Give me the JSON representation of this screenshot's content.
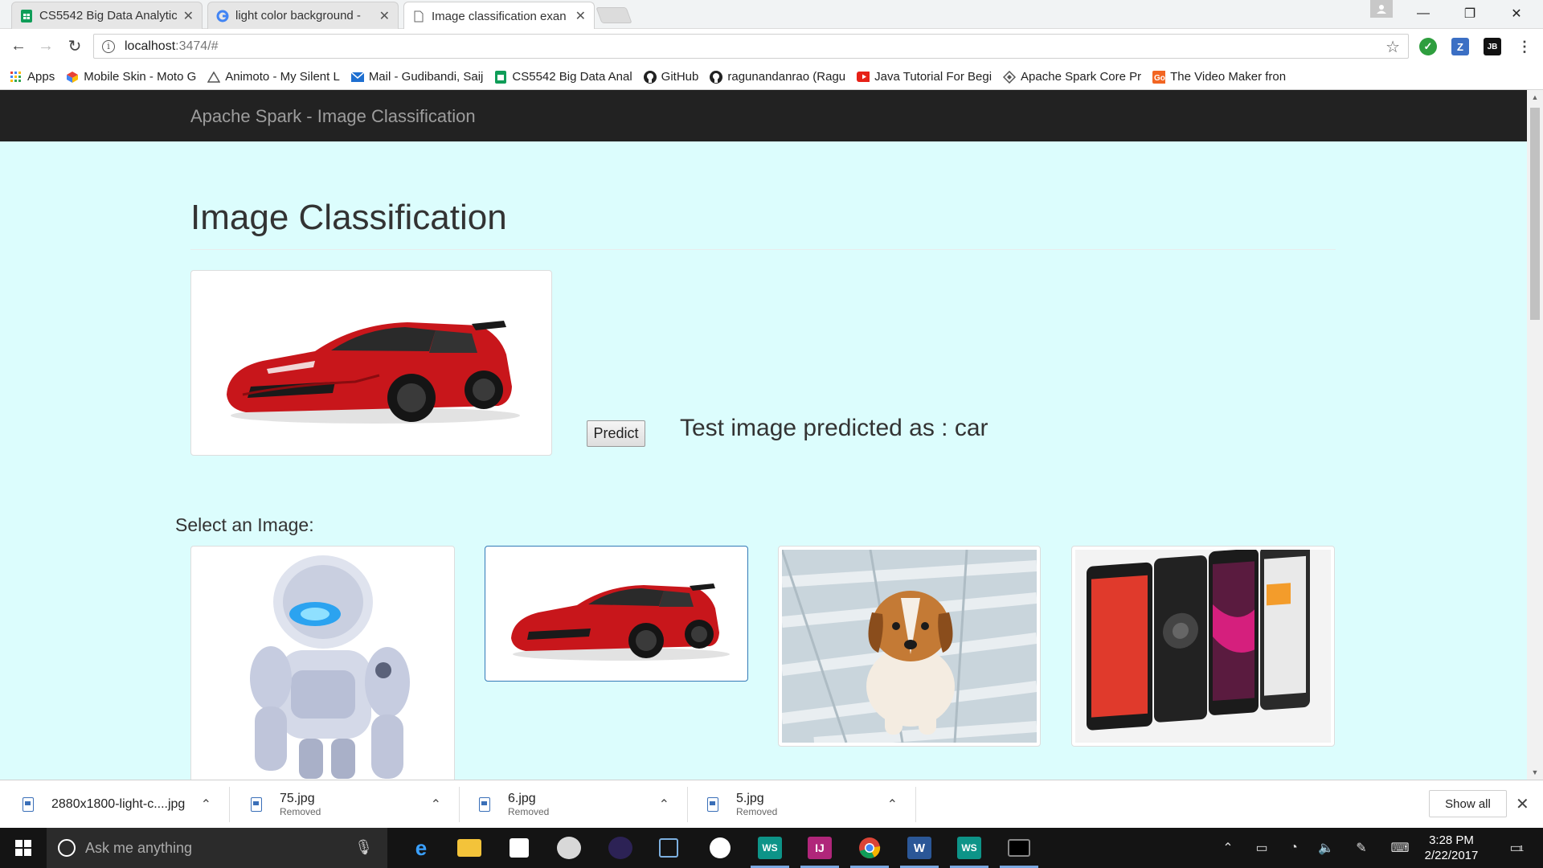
{
  "tabs": [
    {
      "title": "CS5542 Big Data Analytic",
      "icon": "sheets-icon",
      "color": "#0f9d58"
    },
    {
      "title": "light color background -",
      "icon": "google-icon",
      "color": "#4285f4"
    },
    {
      "title": "Image classification exan",
      "icon": "page-icon",
      "color": "#666666"
    }
  ],
  "toolbar": {
    "url_host": "localhost",
    "url_path": ":3474/#"
  },
  "bookmarks": [
    {
      "label": "Apps",
      "icon": "apps-grid-icon"
    },
    {
      "label": "Mobile Skin - Moto G",
      "icon": "cube-icon"
    },
    {
      "label": "Animoto - My Silent L",
      "icon": "animoto-icon"
    },
    {
      "label": "Mail - Gudibandi, Saij",
      "icon": "mail-icon"
    },
    {
      "label": "CS5542 Big Data Anal",
      "icon": "sheets-icon"
    },
    {
      "label": "GitHub",
      "icon": "github-icon"
    },
    {
      "label": "ragunandanrao (Ragu",
      "icon": "github-icon"
    },
    {
      "label": "Java Tutorial For Begi",
      "icon": "youtube-icon"
    },
    {
      "label": "Apache Spark Core Pr",
      "icon": "diamond-icon"
    },
    {
      "label": "The Video Maker fron",
      "icon": "goanimate-icon"
    }
  ],
  "page": {
    "brand": "Apache Spark - Image Classification",
    "title": "Image Classification",
    "predict_label": "Predict",
    "result_text": "Test image predicted as : car",
    "select_label": "Select an Image:",
    "gallery": [
      {
        "subject": "robot",
        "selected": false
      },
      {
        "subject": "red sports car",
        "selected": true
      },
      {
        "subject": "puppy",
        "selected": false
      },
      {
        "subject": "smartphones",
        "selected": false
      }
    ]
  },
  "downloads": [
    {
      "name": "2880x1800-light-c....jpg",
      "status": ""
    },
    {
      "name": "75.jpg",
      "status": "Removed"
    },
    {
      "name": "6.jpg",
      "status": "Removed"
    },
    {
      "name": "5.jpg",
      "status": "Removed"
    }
  ],
  "downloads_show_all": "Show all",
  "taskbar": {
    "search_placeholder": "Ask me anything",
    "time": "3:28 PM",
    "date": "2/22/2017",
    "notification_count": "1"
  },
  "colors": {
    "page_background": "#dcfdfd",
    "navbar": "#222222",
    "selected_border": "#337ab7",
    "car_red": "#d0181c"
  }
}
